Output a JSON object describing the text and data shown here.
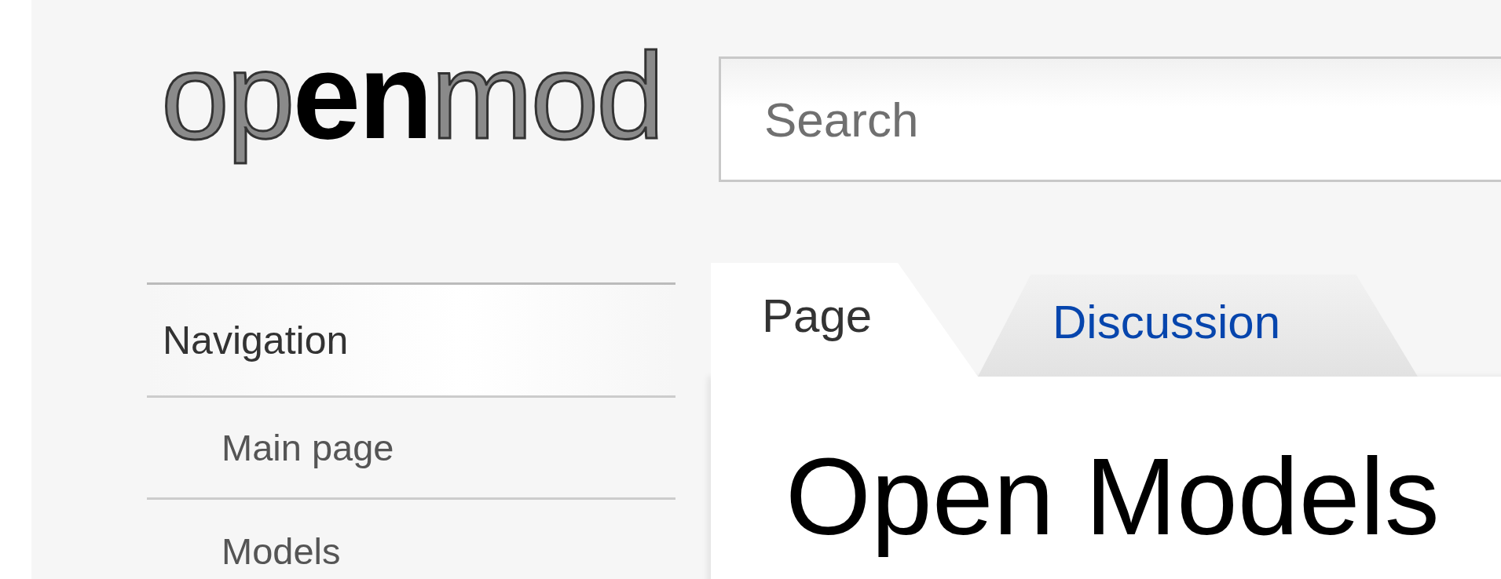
{
  "logo": {
    "text": "op**en**mod"
  },
  "search": {
    "placeholder": "Search"
  },
  "navigation": {
    "heading": "Navigation",
    "items": [
      {
        "label": "Main page"
      },
      {
        "label": "Models"
      }
    ]
  },
  "tabs": [
    {
      "label": "Page",
      "selected": true
    },
    {
      "label": "Discussion",
      "selected": false
    }
  ],
  "page": {
    "title": "Open Models"
  }
}
